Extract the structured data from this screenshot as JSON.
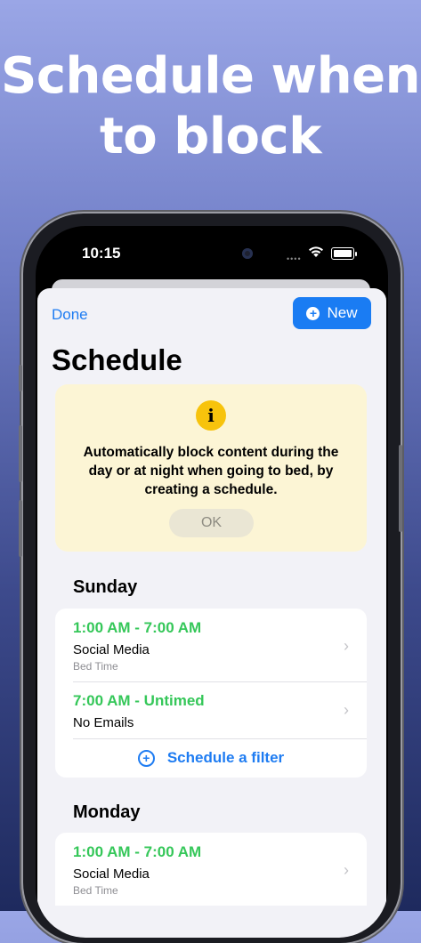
{
  "headline": {
    "line1": "Schedule when",
    "line2": "to block"
  },
  "status_bar": {
    "time": "10:15"
  },
  "nav": {
    "done_label": "Done",
    "new_label": "New"
  },
  "page_title": "Schedule",
  "info_card": {
    "icon": "info-icon",
    "message": "Automatically block content during the day or at night when going to bed, by creating a schedule.",
    "ok_label": "OK"
  },
  "days": [
    {
      "name": "Sunday",
      "items": [
        {
          "time": "1:00 AM - 7:00 AM",
          "name": "Social Media",
          "subtitle": "Bed Time"
        },
        {
          "time": "7:00 AM - Untimed",
          "name": "No Emails",
          "subtitle": ""
        }
      ],
      "add_label": "Schedule a filter"
    },
    {
      "name": "Monday",
      "items": [
        {
          "time": "1:00 AM - 7:00 AM",
          "name": "Social Media",
          "subtitle": "Bed Time"
        }
      ]
    }
  ],
  "colors": {
    "accent": "#1a7cf3",
    "time_green": "#35c759",
    "info_bg": "#fcf5d5",
    "info_icon": "#f7c30c"
  }
}
